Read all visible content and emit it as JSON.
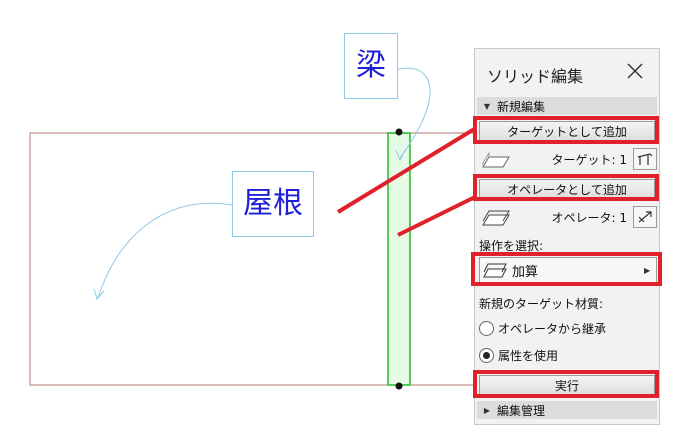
{
  "callouts": {
    "beam": "梁",
    "roof": "屋根"
  },
  "panel": {
    "title": "ソリッド編集",
    "section_new": "新規編集",
    "add_target_button": "ターゲットとして追加",
    "target_label": "ターゲット: 1",
    "add_operator_button": "オペレータとして追加",
    "operator_label": "オペレータ: 1",
    "select_operation_label": "操作を選択:",
    "operation_value": "加算",
    "new_target_material_label": "新規のターゲット材質:",
    "radio_inherit": "オペレータから継承",
    "radio_use_attr": "属性を使用",
    "execute_button": "実行",
    "section_manage": "編集管理"
  },
  "colors": {
    "highlight": "#e0202a",
    "callout_text": "#1f1fd8",
    "beam_fill": "#e6fbe6",
    "beam_stroke": "#22bb22",
    "roof_stroke": "#b47a72",
    "arrow": "#8ec9e6"
  }
}
